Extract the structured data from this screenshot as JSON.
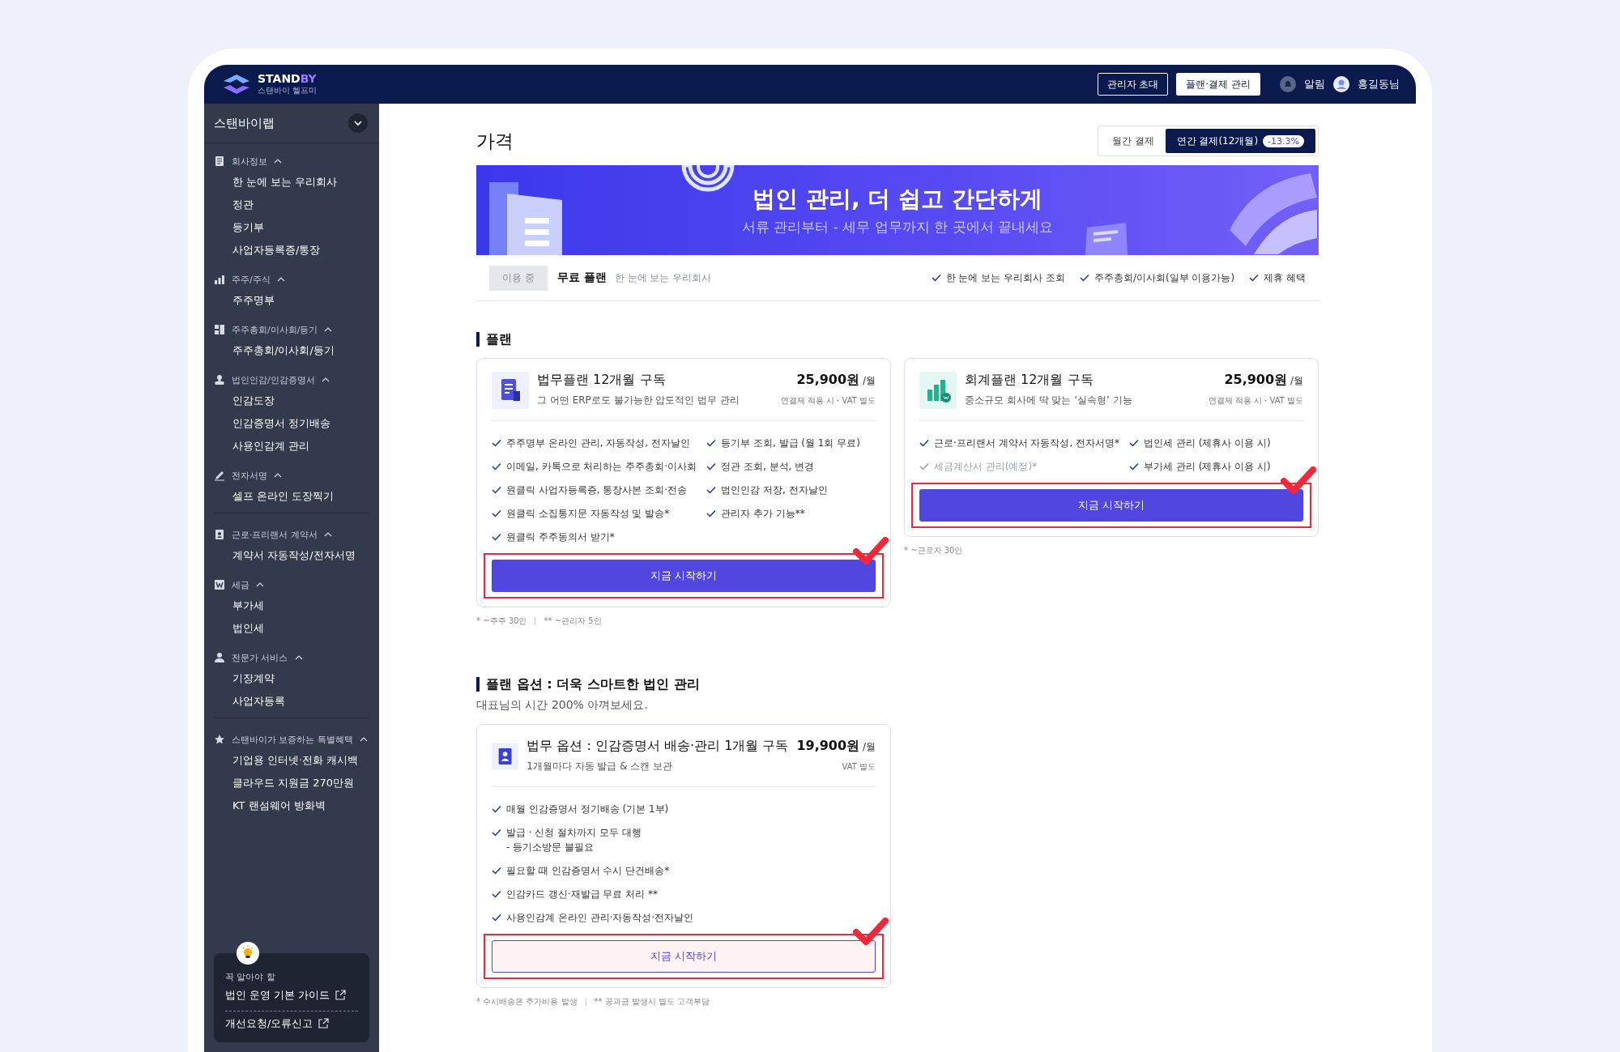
{
  "header": {
    "logo": {
      "brand_main": "STAND",
      "brand_accent": "BY",
      "tagline": "스탠바이 헬프미"
    },
    "buttons": [
      {
        "label": "관리자 초대",
        "selected": false
      },
      {
        "label": "플랜·결제 관리",
        "selected": true
      }
    ],
    "notifications": "알림",
    "user": "홍길동님"
  },
  "sidebar": {
    "company": "스탠바이랩",
    "sections": [
      [
        {
          "kind": "document",
          "title": "회사정보",
          "expanded": true,
          "items": [
            "한 눈에 보는 우리회사",
            "정관",
            "등기부",
            "사업자등록증/통장"
          ]
        },
        {
          "kind": "chart",
          "title": "주주/주식",
          "expanded": true,
          "items": [
            "주주명부"
          ]
        },
        {
          "kind": "board",
          "title": "주주총회/이사회/등기",
          "expanded": true,
          "items": [
            "주주총회/이사회/등기"
          ]
        },
        {
          "kind": "seal",
          "title": "법인인감/인감증명서",
          "expanded": true,
          "items": [
            "인감도장",
            "인감증명서 정기배송",
            "사용인감계 관리"
          ]
        },
        {
          "kind": "pen",
          "title": "전자서명",
          "expanded": true,
          "items": [
            "셀프 온라인 도장찍기"
          ]
        }
      ],
      [
        {
          "kind": "contact",
          "title": "근로·프리랜서 계약서",
          "expanded": true,
          "items": [
            "계약서 자동작성/전자서명"
          ]
        },
        {
          "kind": "won",
          "title": "세금",
          "expanded": true,
          "items": [
            "부가세",
            "법인세"
          ]
        },
        {
          "kind": "person",
          "title": "전문가 서비스",
          "expanded": true,
          "items": [
            "기장계약",
            "사업자등록"
          ]
        }
      ],
      [
        {
          "kind": "star",
          "title": "스탠바이가 보증하는 특별혜택",
          "expanded": true,
          "items": [
            "기업용 인터넷·전화 캐시백",
            "클라우드 지원금 270만원",
            "KT 랜섬웨어 방화벽"
          ]
        }
      ]
    ],
    "guide": {
      "eyebrow": "꼭 알아야 할",
      "links": [
        "법인 운영 기본 가이드",
        "개선요청/오류신고"
      ]
    }
  },
  "main": {
    "title": "가격",
    "billing": [
      {
        "label": "월간 결제",
        "selected": false
      },
      {
        "label": "연간 결제(12개월)",
        "selected": true,
        "badge": "-13.3%"
      }
    ],
    "banner": {
      "title": "법인 관리, 더 쉽고 간단하게",
      "subtitle": "서류 관리부터 - 세무 업무까지 한 곳에서 끝내세요"
    },
    "current_plan": {
      "status": "이용 중",
      "name": "무료 플랜",
      "description": "한 눈에 보는 우리회사",
      "features": [
        "한 눈에 보는 우리회사 조회",
        "주주총회/이사회(일부 이용가능)",
        "제휴 혜택"
      ]
    },
    "plans_section": {
      "title": "플랜",
      "plans": [
        {
          "kind": "legal",
          "name": "법무플랜 12개월 구독",
          "description": "그 어떤 ERP로도 불가능한 압도적인 법무 관리",
          "price": "25,900원",
          "unit": "/월",
          "note": "연결제 적용 시 · VAT 별도",
          "feature_columns": [
            [
              {
                "text": "주주명부 온라인 관리, 자동작성, 전자날인",
                "disabled": false
              },
              {
                "text": "이메일, 카톡으로 처리하는 주주총회·이사회",
                "disabled": false
              },
              {
                "text": "원클릭 사업자등록증, 통장사본 조회·전송",
                "disabled": false
              },
              {
                "text": "원클릭 소집통지문 자동작성 및 발송*",
                "disabled": false
              },
              {
                "text": "원클릭 주주동의서 받기*",
                "disabled": false
              }
            ],
            [
              {
                "text": "등기부 조회, 발급 (월 1회 무료)",
                "disabled": false
              },
              {
                "text": "정관 조회, 분석, 변경",
                "disabled": false
              },
              {
                "text": "법인인감 저장, 전자날인",
                "disabled": false
              },
              {
                "text": "관리자 추가 기능**",
                "disabled": false
              }
            ]
          ],
          "button": {
            "label": "지금 시작하기",
            "kind": "filled"
          },
          "highlighted": true,
          "footnotes": [
            "* ~주주 30인",
            "** ~관리자 5인"
          ]
        },
        {
          "kind": "accounting",
          "name": "회계플랜 12개월 구독",
          "description": "중소규모 회사에 딱 맞는 ‘실속형’ 기능",
          "price": "25,900원",
          "unit": "/월",
          "note": "연결제 적용 시 · VAT 별도",
          "feature_columns": [
            [
              {
                "text": "근로·프리랜서 계약서 자동작성, 전자서명*",
                "disabled": false
              },
              {
                "text": "세금계산서 관리(예정)*",
                "disabled": true
              }
            ],
            [
              {
                "text": "법인세 관리 (제휴사 이용 시)",
                "disabled": false
              },
              {
                "text": "부가세 관리 (제휴사 이용 시)",
                "disabled": false
              }
            ]
          ],
          "button": {
            "label": "지금 시작하기",
            "kind": "filled"
          },
          "highlighted": true,
          "footnotes": [
            "* ~근로자 30인"
          ]
        }
      ]
    },
    "options_section": {
      "title": "플랜 옵션 : 더욱 스마트한 법인 관리",
      "subtitle": "대표님의 시간 200% 아껴보세요.",
      "plans": [
        {
          "kind": "seal",
          "name": "법무 옵션 : 인감증명서 배송·관리 1개월 구독",
          "description": "1개월마다 자동 발급 & 스캔 보관",
          "price": "19,900원",
          "unit": "/월",
          "note": "VAT 별도",
          "feature_columns": [
            [
              {
                "text": "매월 인감증명서 정기배송 (기본 1부)",
                "disabled": false
              },
              {
                "text": "발급 · 신청 절차까지 모두 대행\n- 등기소방문 불필요",
                "disabled": false
              },
              {
                "text": "필요할 때 인감증명서 수시 단건배송*",
                "disabled": false
              },
              {
                "text": "인감카드 갱신·재발급 무료 처리 **",
                "disabled": false
              },
              {
                "text": "사용인감계 온라인 관리·자동작성·전자날인",
                "disabled": false
              }
            ]
          ],
          "button": {
            "label": "지금 시작하기",
            "kind": "outline"
          },
          "highlighted": true,
          "footnotes": [
            "* 수시배송은 추가비용 발생",
            "** 공과금 발생시 별도 고객부담"
          ]
        }
      ]
    }
  }
}
